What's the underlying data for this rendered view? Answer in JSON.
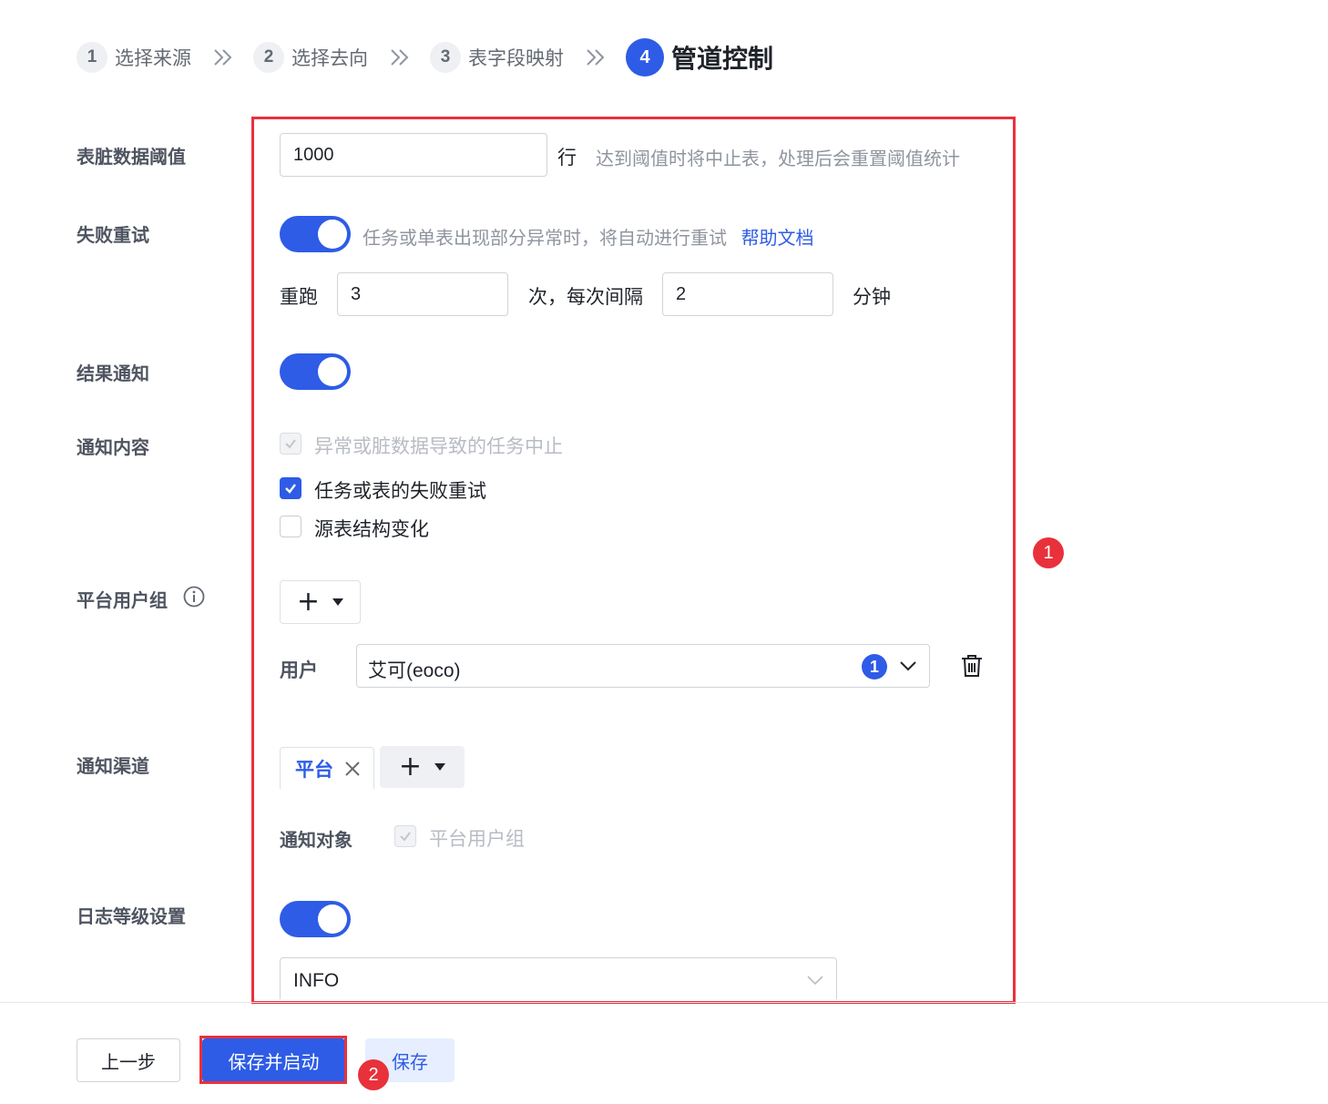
{
  "steps": [
    {
      "num": "1",
      "label": "选择来源"
    },
    {
      "num": "2",
      "label": "选择去向"
    },
    {
      "num": "3",
      "label": "表字段映射"
    },
    {
      "num": "4",
      "label": "管道控制"
    }
  ],
  "dirty_threshold": {
    "label": "表脏数据阈值",
    "value": "1000",
    "unit": "行",
    "hint": "达到阈值时将中止表，处理后会重置阈值统计"
  },
  "retry": {
    "label": "失败重试",
    "enabled": true,
    "hint": "任务或单表出现部分异常时，将自动进行重试",
    "help_link": "帮助文档",
    "rerun_label": "重跑",
    "times": "3",
    "times_suffix": "次，每次间隔",
    "interval": "2",
    "interval_unit": "分钟"
  },
  "result_notify": {
    "label": "结果通知",
    "enabled": true
  },
  "notify_content": {
    "label": "通知内容",
    "options": [
      {
        "label": "异常或脏数据导致的任务中止",
        "checked": true,
        "disabled": true
      },
      {
        "label": "任务或表的失败重试",
        "checked": true,
        "disabled": false
      },
      {
        "label": "源表结构变化",
        "checked": false,
        "disabled": false
      }
    ]
  },
  "user_group": {
    "label": "平台用户组",
    "user_label": "用户",
    "user_value": "艾可(eoco)",
    "user_count": "1"
  },
  "channel": {
    "label": "通知渠道",
    "tab": "平台",
    "target_label": "通知对象",
    "target_option": "平台用户组"
  },
  "log_level": {
    "label": "日志等级设置",
    "enabled": true,
    "value": "INFO"
  },
  "annotations": {
    "badge1": "1",
    "badge2": "2"
  },
  "footer": {
    "prev": "上一步",
    "save_start": "保存并启动",
    "save": "保存"
  },
  "colors": {
    "primary": "#2e5ce6",
    "annotation": "#e8313b"
  }
}
